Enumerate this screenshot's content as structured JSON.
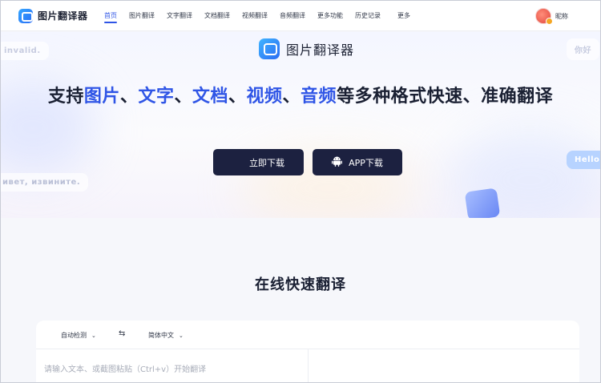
{
  "app": {
    "name": "图片翻译器"
  },
  "nav": {
    "items": [
      {
        "label": "首页",
        "active": true
      },
      {
        "label": "图片翻译"
      },
      {
        "label": "文字翻译"
      },
      {
        "label": "文档翻译"
      },
      {
        "label": "视频翻译"
      },
      {
        "label": "音频翻译"
      },
      {
        "label": "更多功能"
      },
      {
        "label": "历史记录"
      },
      {
        "label": "更多"
      }
    ],
    "user_nickname": "昵称"
  },
  "hero": {
    "brand_name": "图片翻译器",
    "headline_parts": {
      "p1": "支持",
      "h1": "图片",
      "s1": "、",
      "h2": "文字",
      "s2": "、",
      "h3": "文档",
      "s3": "、",
      "h4": "视频",
      "s4": "、",
      "h5": "音频",
      "tail": "等多种格式快速、准确翻译"
    },
    "bubbles": {
      "b1": "invalid.",
      "b2": "你好",
      "b3": "ивет, извините.",
      "b4": "Hello"
    },
    "buttons": {
      "windows": "立即下载",
      "app": "APP下载"
    }
  },
  "translate": {
    "title": "在线快速翻译",
    "source_lang": "自动检测",
    "target_lang": "简体中文",
    "input_placeholder": "请输入文本、或截图粘贴（Ctrl+v）开始翻译"
  },
  "colors": {
    "accent": "#2f55e6",
    "button_dark": "#1c2140",
    "text_dark": "#1a2033"
  }
}
